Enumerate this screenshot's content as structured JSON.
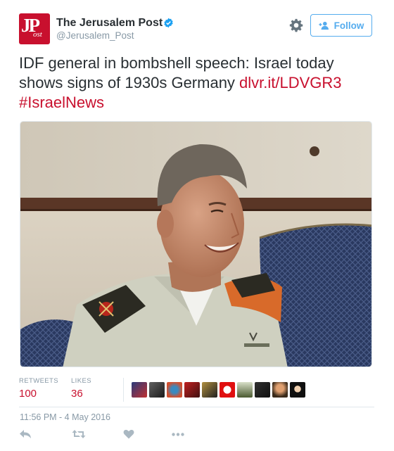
{
  "account": {
    "name": "The Jerusalem Post",
    "handle": "@Jerusalem_Post",
    "avatar_text_main": "JP",
    "avatar_text_sub": "ost",
    "verified": true
  },
  "header": {
    "follow_label": "Follow",
    "settings_icon": "gear-icon"
  },
  "tweet": {
    "text_line1": "IDF general in bombshell speech: Israel today",
    "text_line2_plain": "shows signs of 1930s Germany ",
    "link": "dlvr.it/LDVGR3",
    "hashtag": "#IsraelNews"
  },
  "stats": {
    "retweets_label": "RETWEETS",
    "retweets_value": "100",
    "likes_label": "LIKES",
    "likes_value": "36"
  },
  "timestamp": "11:56 PM - 4 May 2016",
  "actions": [
    "reply-icon",
    "retweet-icon",
    "like-icon",
    "more-icon"
  ],
  "colors": {
    "brand_red": "#c8102e",
    "twitter_blue": "#55acee",
    "muted": "#8899a6"
  }
}
